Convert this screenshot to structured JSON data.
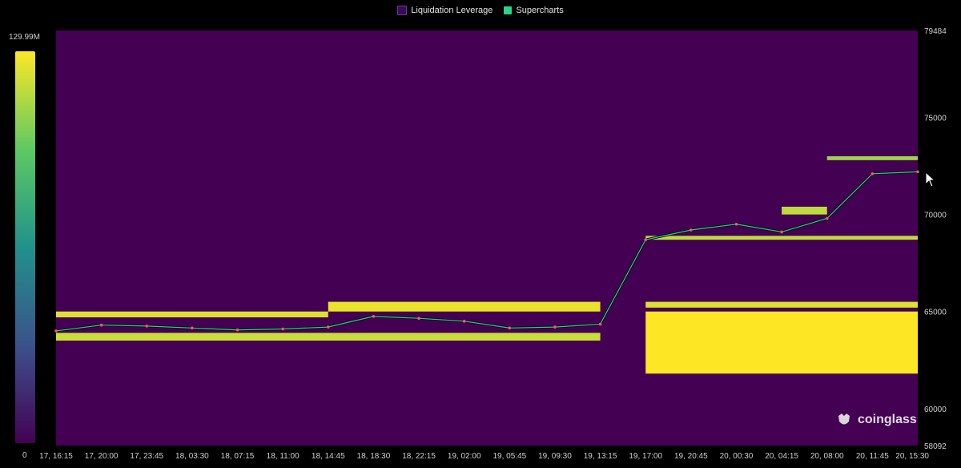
{
  "legend": [
    {
      "label": "Liquidation Leverage",
      "color": "#3b0a59"
    },
    {
      "label": "Supercharts",
      "color": "#2ad28a"
    }
  ],
  "colorbar": {
    "max_label": "129.99M",
    "min_label": "0"
  },
  "watermark": {
    "text": "coinglass"
  },
  "chart_data": {
    "type": "heatmap",
    "title": "",
    "xlabel": "",
    "ylabel": "",
    "ylim": [
      58092,
      79484
    ],
    "y_ticks": [
      "79484",
      "75000",
      "70000",
      "65000",
      "60000",
      "58092"
    ],
    "x_ticks": [
      "17, 16:15",
      "17, 20:00",
      "17, 23:45",
      "18, 03:30",
      "18, 07:15",
      "18, 11:00",
      "18, 14:45",
      "18, 18:30",
      "18, 22:15",
      "19, 02:00",
      "19, 05:45",
      "19, 09:30",
      "19, 13:15",
      "19, 17:00",
      "19, 20:45",
      "20, 00:30",
      "20, 04:15",
      "20, 08:00",
      "20, 11:45",
      "20, 15:30"
    ],
    "colorscale": {
      "min": 0,
      "max": 129990000,
      "stops": [
        "#440154",
        "#3b528b",
        "#21918c",
        "#5ec962",
        "#fde725"
      ]
    },
    "liquidation_bands": [
      {
        "price_from": 64700,
        "price_to": 65000,
        "t_from": "17, 16:15",
        "t_to": "18, 14:45",
        "intensity": 0.95
      },
      {
        "price_from": 63500,
        "price_to": 63900,
        "t_from": "17, 16:15",
        "t_to": "19, 13:15",
        "intensity": 0.92
      },
      {
        "price_from": 65000,
        "price_to": 65500,
        "t_from": "18, 14:45",
        "t_to": "19, 13:15",
        "intensity": 0.97
      },
      {
        "price_from": 61800,
        "price_to": 65000,
        "t_from": "19, 17:00",
        "t_to": "20, 15:30",
        "intensity": 1.0
      },
      {
        "price_from": 65200,
        "price_to": 65500,
        "t_from": "19, 17:00",
        "t_to": "20, 15:30",
        "intensity": 0.95
      },
      {
        "price_from": 68700,
        "price_to": 68900,
        "t_from": "19, 17:00",
        "t_to": "20, 15:30",
        "intensity": 0.9
      },
      {
        "price_from": 70000,
        "price_to": 70400,
        "t_from": "20, 04:15",
        "t_to": "20, 08:00",
        "intensity": 0.9
      },
      {
        "price_from": 72800,
        "price_to": 73000,
        "t_from": "20, 08:00",
        "t_to": "20, 15:30",
        "intensity": 0.85
      }
    ],
    "price_series": [
      {
        "t": "17, 16:15",
        "p": 64000
      },
      {
        "t": "17, 20:00",
        "p": 64300
      },
      {
        "t": "17, 23:45",
        "p": 64250
      },
      {
        "t": "18, 03:30",
        "p": 64150
      },
      {
        "t": "18, 07:15",
        "p": 64050
      },
      {
        "t": "18, 11:00",
        "p": 64100
      },
      {
        "t": "18, 14:45",
        "p": 64200
      },
      {
        "t": "18, 18:30",
        "p": 64750
      },
      {
        "t": "18, 22:15",
        "p": 64650
      },
      {
        "t": "19, 02:00",
        "p": 64500
      },
      {
        "t": "19, 05:45",
        "p": 64150
      },
      {
        "t": "19, 09:30",
        "p": 64200
      },
      {
        "t": "19, 13:15",
        "p": 64350
      },
      {
        "t": "19, 17:00",
        "p": 68700
      },
      {
        "t": "19, 20:45",
        "p": 69200
      },
      {
        "t": "20, 00:30",
        "p": 69500
      },
      {
        "t": "20, 04:15",
        "p": 69100
      },
      {
        "t": "20, 08:00",
        "p": 69800
      },
      {
        "t": "20, 11:45",
        "p": 72100
      },
      {
        "t": "20, 15:30",
        "p": 72200
      }
    ]
  }
}
